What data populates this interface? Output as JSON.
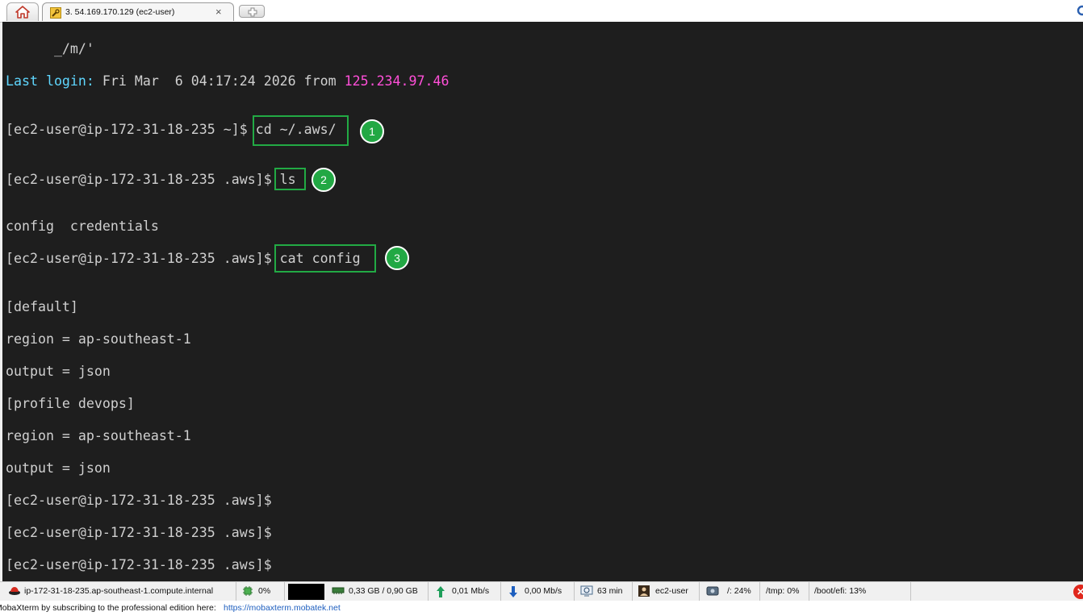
{
  "tabs": {
    "session_title": "3. 54.169.170.129 (ec2-user)",
    "close_glyph": "×"
  },
  "terminal": {
    "lines": [
      {
        "id": "l0",
        "text": "      _/m/'"
      },
      {
        "id": "l1a",
        "text": "Last login:"
      },
      {
        "id": "l1b",
        "text": " Fri Mar  6 04:17:24 2026 from "
      },
      {
        "id": "l1c",
        "text": "125.234.97.46"
      },
      {
        "id": "l2a",
        "text": "[ec2-user@ip-172-31-18-235 ~]$ "
      },
      {
        "id": "l2b",
        "text": "cd ~/.aws/"
      },
      {
        "id": "l3a",
        "text": "[ec2-user@ip-172-31-18-235 .aws]$ "
      },
      {
        "id": "l3b",
        "text": "ls"
      },
      {
        "id": "l4",
        "text": "config  credentials"
      },
      {
        "id": "l5a",
        "text": "[ec2-user@ip-172-31-18-235 .aws]$ "
      },
      {
        "id": "l5b",
        "text": "cat config"
      },
      {
        "id": "l6",
        "text": "[default]"
      },
      {
        "id": "l7",
        "text": "region = ap-southeast-1"
      },
      {
        "id": "l8",
        "text": "output = json"
      },
      {
        "id": "l9",
        "text": "[profile devops]"
      },
      {
        "id": "l10",
        "text": "region = ap-southeast-1"
      },
      {
        "id": "l11",
        "text": "output = json"
      },
      {
        "id": "l12",
        "text": "[ec2-user@ip-172-31-18-235 .aws]$"
      },
      {
        "id": "l13",
        "text": "[ec2-user@ip-172-31-18-235 .aws]$"
      },
      {
        "id": "l14",
        "text": "[ec2-user@ip-172-31-18-235 .aws]$"
      }
    ],
    "annotations": [
      "1",
      "2",
      "3"
    ],
    "colors": {
      "background": "#1e1e1e",
      "text": "#d0d0d0",
      "label": "#5fd7ff",
      "ip": "#ff4fd8",
      "highlight": "#22aa44"
    }
  },
  "statusbar": {
    "host": "ip-172-31-18-235.ap-southeast-1.compute.internal",
    "cpu": "0%",
    "memory": "0,33 GB / 0,90 GB",
    "upload": "0,01 Mb/s",
    "download": "0,00 Mb/s",
    "uptime": "63 min",
    "user": "ec2-user",
    "disk_root": "/: 24%",
    "disk_tmp": "/tmp: 0%",
    "disk_boot": "/boot/efi: 13%"
  },
  "footer": {
    "text": "MobaXterm by subscribing to the professional edition here:",
    "link": "https://mobaxterm.mobatek.net"
  }
}
